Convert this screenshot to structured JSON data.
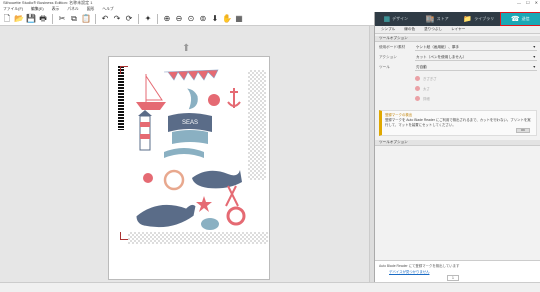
{
  "window": {
    "title": "Silhouette Studio® Business Edition: 名称未設定 1"
  },
  "menu": [
    "ファイル(F)",
    "編集(E)",
    "表示",
    "パネル",
    "図形",
    "ヘルプ"
  ],
  "toolbar": {
    "icons": [
      "new-doc-icon",
      "open-icon",
      "save-icon",
      "print-icon",
      "cut-icon",
      "copy-icon",
      "paste-icon",
      "undo-icon",
      "redo-icon",
      "rotate-icon",
      "sparkle-icon",
      "zoom-in-icon",
      "zoom-out-icon",
      "zoom-fit-icon",
      "pan-icon",
      "down-arrow-icon",
      "hand-icon",
      "grid-icon"
    ],
    "glyphs": [
      "🗋",
      "📂",
      "💾",
      "🖶",
      "✂",
      "⧉",
      "📋",
      "↶",
      "↷",
      "⟳",
      "✦",
      "⊕",
      "⊖",
      "⊙",
      "⊚",
      "⬇",
      "✋",
      "▦"
    ]
  },
  "panel": {
    "tabs": [
      {
        "label": "デザイン",
        "icon": "▦"
      },
      {
        "label": "ストア",
        "icon": "🏬"
      },
      {
        "label": "ライブラリ",
        "icon": "📁"
      },
      {
        "label": "送信",
        "icon": "☎"
      }
    ],
    "subtabs": [
      "シンプル",
      "線の色",
      "塗りつぶし",
      "レイヤー"
    ],
    "section_cut": "ツールオプション",
    "material_label": "使用ボード/素材",
    "material_value": "ケント紙（画用紙）、厚手",
    "action_label": "アクション",
    "action_value": "カット（ペンを使用しません）",
    "tool_label": "ツール",
    "tool_value": "刃自動",
    "options": [
      "ぎざぎざ",
      "太さ",
      "詳細"
    ],
    "notice_title": "登録マークの検出",
    "notice_text": "登録マークを Auto Blade Reader にご利用で検出されるまで、カットを行わない。プリントを実行して、マットを装置にセットしてください。",
    "notice_ok": "OK",
    "section_details": "ツールオプション",
    "status_text": "Auto Blade Reader にて登録マークを検出しています",
    "link_text": "デバイスが見つかりません",
    "copies": "1",
    "send_label": "送信"
  }
}
